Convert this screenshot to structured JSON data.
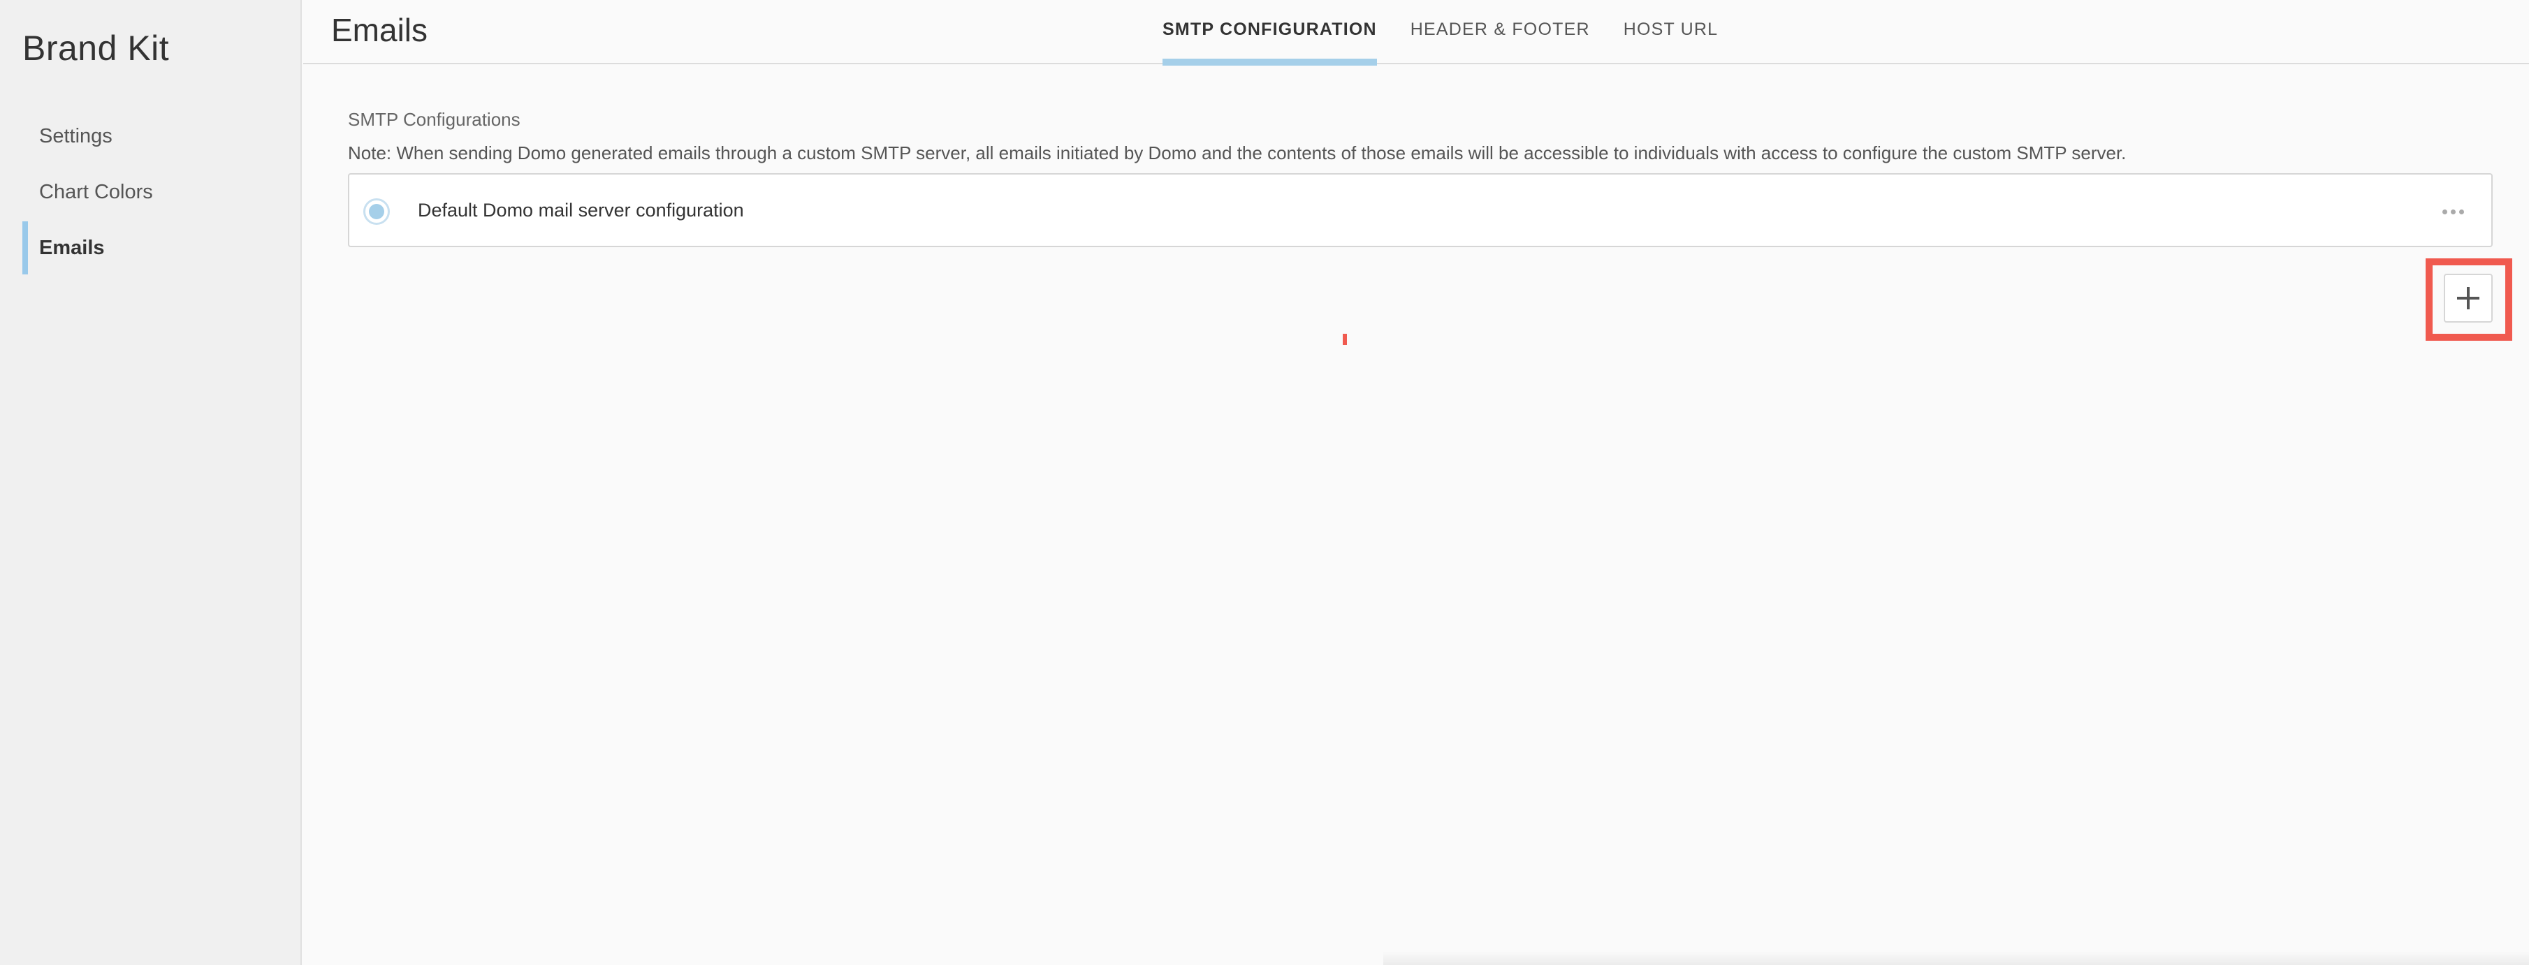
{
  "sidebar": {
    "title": "Brand Kit",
    "items": [
      {
        "label": "Settings"
      },
      {
        "label": "Chart Colors"
      },
      {
        "label": "Emails"
      }
    ]
  },
  "header": {
    "title": "Emails",
    "tabs": [
      {
        "label": "SMTP CONFIGURATION"
      },
      {
        "label": "HEADER & FOOTER"
      },
      {
        "label": "HOST URL"
      }
    ]
  },
  "main": {
    "section_title": "SMTP Configurations",
    "note": "Note: When sending Domo generated emails through a custom SMTP server, all emails initiated by Domo and the contents of those emails will be accessible to individuals with access to configure the custom SMTP server.",
    "configurations": [
      {
        "label": "Default Domo mail server configuration",
        "selected": true
      }
    ]
  },
  "icons": {
    "more": "more-horizontal-icon",
    "add": "plus-icon",
    "radio": "radio-selected-icon"
  },
  "colors": {
    "accent": "#a5cfe9",
    "highlight": "#f05a4f"
  }
}
